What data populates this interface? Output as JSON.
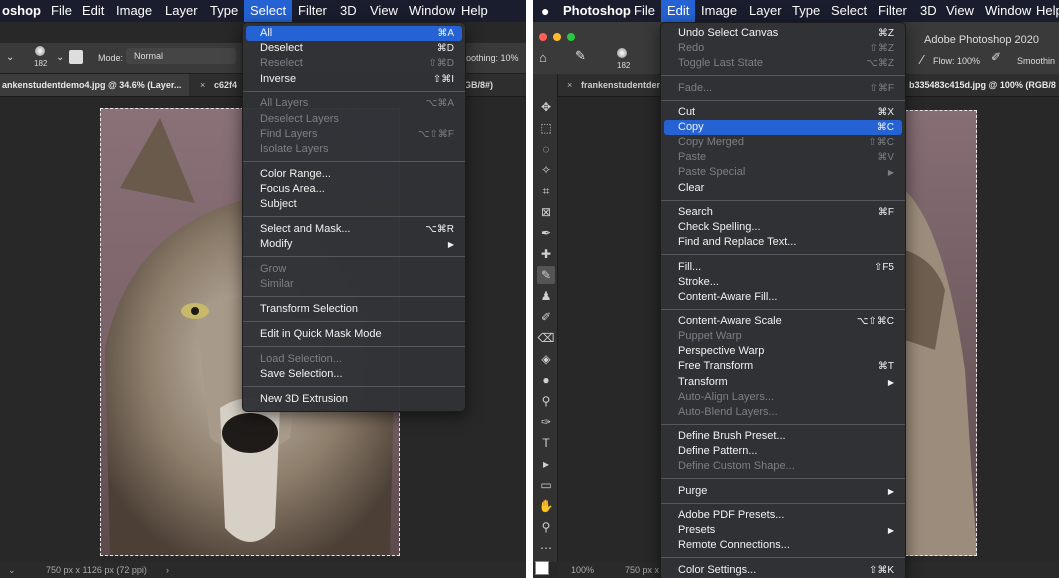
{
  "left": {
    "menubar": [
      "oshop",
      "File",
      "Edit",
      "Image",
      "Layer",
      "Type",
      "Select",
      "Filter",
      "3D",
      "View",
      "Window",
      "Help"
    ],
    "options": {
      "brush_size": "182",
      "mode_label": "Mode:",
      "mode_value": "Normal",
      "smoothing": "oothing: 10%"
    },
    "tabs": [
      "ankenstudentdemo4.jpg @ 34.6% (Layer...",
      "c62f4",
      "GB/8#)"
    ],
    "status": "750 px x 1126 px (72 ppi)",
    "menu": [
      {
        "label": "All",
        "shortcut": "⌘A",
        "selected": true
      },
      {
        "label": "Deselect",
        "shortcut": "⌘D"
      },
      {
        "label": "Reselect",
        "shortcut": "⇧⌘D",
        "disabled": true
      },
      {
        "label": "Inverse",
        "shortcut": "⇧⌘I"
      },
      {
        "sep": true
      },
      {
        "label": "All Layers",
        "shortcut": "⌥⌘A",
        "disabled": true
      },
      {
        "label": "Deselect Layers",
        "disabled": true
      },
      {
        "label": "Find Layers",
        "shortcut": "⌥⇧⌘F",
        "disabled": true
      },
      {
        "label": "Isolate Layers",
        "disabled": true
      },
      {
        "sep": true
      },
      {
        "label": "Color Range..."
      },
      {
        "label": "Focus Area..."
      },
      {
        "label": "Subject"
      },
      {
        "sep": true
      },
      {
        "label": "Select and Mask...",
        "shortcut": "⌥⌘R"
      },
      {
        "label": "Modify",
        "submenu": true
      },
      {
        "sep": true
      },
      {
        "label": "Grow",
        "disabled": true
      },
      {
        "label": "Similar",
        "disabled": true
      },
      {
        "sep": true
      },
      {
        "label": "Transform Selection"
      },
      {
        "sep": true
      },
      {
        "label": "Edit in Quick Mask Mode"
      },
      {
        "sep": true
      },
      {
        "label": "Load Selection...",
        "disabled": true
      },
      {
        "label": "Save Selection..."
      },
      {
        "sep": true
      },
      {
        "label": "New 3D Extrusion"
      }
    ]
  },
  "right": {
    "menubar": [
      "",
      "Photoshop",
      "File",
      "Edit",
      "Image",
      "Layer",
      "Type",
      "Select",
      "Filter",
      "3D",
      "View",
      "Window",
      "Help"
    ],
    "options": {
      "brush_size": "182",
      "title": "Adobe Photoshop 2020",
      "flow": "Flow: 100%",
      "smoothing": "Smoothin"
    },
    "tabs": [
      "frankenstudentder",
      "b335483c415d.jpg @ 100% (RGB/8"
    ],
    "status_zoom": "100%",
    "status_dims": "750 px x",
    "menu": [
      {
        "label": "Undo Select Canvas",
        "shortcut": "⌘Z"
      },
      {
        "label": "Redo",
        "shortcut": "⇧⌘Z",
        "disabled": true
      },
      {
        "label": "Toggle Last State",
        "shortcut": "⌥⌘Z",
        "disabled": true
      },
      {
        "sep": true
      },
      {
        "label": "Fade...",
        "shortcut": "⇧⌘F",
        "disabled": true
      },
      {
        "sep": true
      },
      {
        "label": "Cut",
        "shortcut": "⌘X"
      },
      {
        "label": "Copy",
        "shortcut": "⌘C",
        "selected": true
      },
      {
        "label": "Copy Merged",
        "shortcut": "⇧⌘C",
        "disabled": true
      },
      {
        "label": "Paste",
        "shortcut": "⌘V",
        "disabled": true
      },
      {
        "label": "Paste Special",
        "submenu": true,
        "disabled": true
      },
      {
        "label": "Clear"
      },
      {
        "sep": true
      },
      {
        "label": "Search",
        "shortcut": "⌘F"
      },
      {
        "label": "Check Spelling..."
      },
      {
        "label": "Find and Replace Text..."
      },
      {
        "sep": true
      },
      {
        "label": "Fill...",
        "shortcut": "⇧F5"
      },
      {
        "label": "Stroke..."
      },
      {
        "label": "Content-Aware Fill..."
      },
      {
        "sep": true
      },
      {
        "label": "Content-Aware Scale",
        "shortcut": "⌥⇧⌘C"
      },
      {
        "label": "Puppet Warp",
        "disabled": true
      },
      {
        "label": "Perspective Warp"
      },
      {
        "label": "Free Transform",
        "shortcut": "⌘T"
      },
      {
        "label": "Transform",
        "submenu": true
      },
      {
        "label": "Auto-Align Layers...",
        "disabled": true
      },
      {
        "label": "Auto-Blend Layers...",
        "disabled": true
      },
      {
        "sep": true
      },
      {
        "label": "Define Brush Preset..."
      },
      {
        "label": "Define Pattern..."
      },
      {
        "label": "Define Custom Shape...",
        "disabled": true
      },
      {
        "sep": true
      },
      {
        "label": "Purge",
        "submenu": true
      },
      {
        "sep": true
      },
      {
        "label": "Adobe PDF Presets..."
      },
      {
        "label": "Presets",
        "submenu": true
      },
      {
        "label": "Remote Connections..."
      },
      {
        "sep": true
      },
      {
        "label": "Color Settings...",
        "shortcut": "⇧⌘K"
      }
    ],
    "tools": [
      "move-tool-icon",
      "marquee-tool-icon",
      "lasso-tool-icon",
      "magic-wand-tool-icon",
      "crop-tool-icon",
      "frame-tool-icon",
      "eyedropper-tool-icon",
      "healing-brush-tool-icon",
      "brush-tool-icon",
      "clone-stamp-tool-icon",
      "history-brush-tool-icon",
      "eraser-tool-icon",
      "paint-bucket-tool-icon",
      "blur-tool-icon",
      "dodge-tool-icon",
      "pen-tool-icon",
      "type-tool-icon",
      "path-selection-tool-icon",
      "rectangle-tool-icon",
      "hand-tool-icon",
      "zoom-tool-icon",
      "more-tools-icon"
    ]
  },
  "colors": {
    "menubar": "#1a1d2e",
    "highlight": "#2563d4",
    "menu_bg": "#303236",
    "workspace": "#282828"
  }
}
